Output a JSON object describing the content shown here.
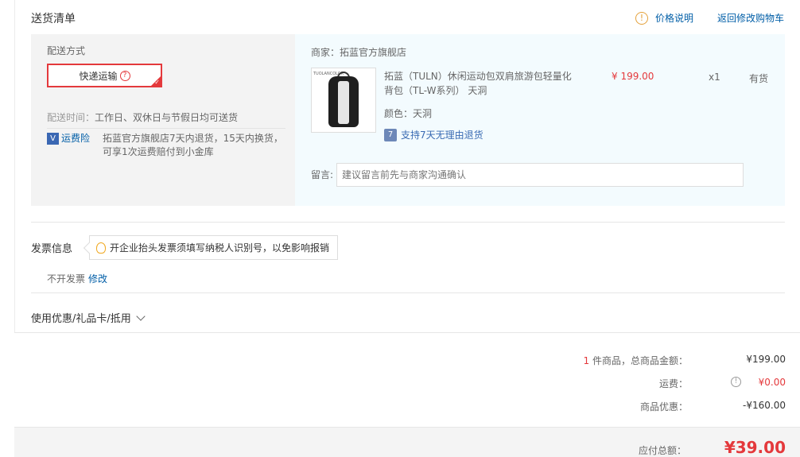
{
  "section": {
    "title": "送货清单"
  },
  "top_links": {
    "price_note": "价格说明",
    "back_to_cart": "返回修改购物车"
  },
  "shipping": {
    "label": "配送方式",
    "method": "快递运输",
    "time_prefix": "配送时间：",
    "time_value": "工作日、双休日与节假日均可送货",
    "insurance_label": "运费险",
    "insurance_text": "拓蓝官方旗舰店7天内退货，15天内换货，可享1次运费赔付到小金库"
  },
  "goods": {
    "merchant": "商家：拓蓝官方旗舰店",
    "thumb_brand": "TUOLANCOLOR",
    "title": "拓蓝（TULN）休闲运动包双肩旅游包轻量化背包（TL-W系列） 天洞",
    "price": "¥ 199.00",
    "qty": "x1",
    "stock": "有货",
    "color": "颜色：天洞",
    "return_icon": "7",
    "return_policy": "支持7天无理由退货",
    "remark_label": "留言:",
    "remark_placeholder": "建议留言前先与商家沟通确认"
  },
  "invoice": {
    "title": "发票信息",
    "tip": "开企业抬头发票须填写纳税人识别号，以免影响报销",
    "status": "不开发票",
    "edit": "修改"
  },
  "coupon": {
    "label": "使用优惠/礼品卡/抵用"
  },
  "totals": {
    "count": "1",
    "count_suffix": "件商品，总商品金额：",
    "goods_amount": "¥199.00",
    "freight_label": "运费：",
    "freight_value": "¥0.00",
    "discount_label": "商品优惠：",
    "discount_value": "-¥160.00",
    "payable_label": "应付总额：",
    "payable_value": "¥39.00"
  },
  "colors": {
    "accent_red": "#e4393c",
    "link_blue": "#005ea7",
    "goods_bg": "#f3fbfe",
    "ship_bg": "#f3f3f3"
  },
  "icons": [
    "info-icon",
    "question-icon",
    "check-corner-icon",
    "shield-icon",
    "return-7day-icon",
    "bulb-icon",
    "chevron-down-icon"
  ]
}
